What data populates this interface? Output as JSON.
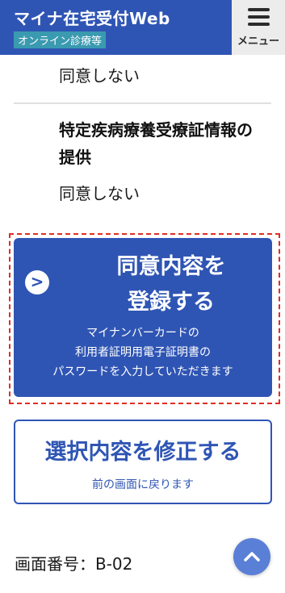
{
  "header": {
    "app_title": "マイナ在宅受付Web",
    "subtitle": "オンライン診療等",
    "menu_label": "メニュー",
    "menu_icon": "hamburger-icon"
  },
  "consent_items": [
    {
      "value": "同意しない"
    },
    {
      "title": "特定疾病療養受療証情報の提供",
      "value": "同意しない"
    }
  ],
  "submit_button": {
    "main_line1": "同意内容を",
    "main_line2": "登録する",
    "sub_line1": "マイナンバーカードの",
    "sub_line2": "利用者証明用電子証明書の",
    "sub_line3": "パスワードを入力していただきます",
    "icon": "chevron-right-icon"
  },
  "edit_button": {
    "main": "選択内容を修正する",
    "sub": "前の画面に戻ります"
  },
  "screen_number": "画面番号：B-02",
  "scroll_top_icon": "chevron-up-icon",
  "colors": {
    "primary": "#2f55b4",
    "badge": "#3a9ab0",
    "highlight": "#e02d21",
    "scroll_top": "#5a7fd6"
  }
}
